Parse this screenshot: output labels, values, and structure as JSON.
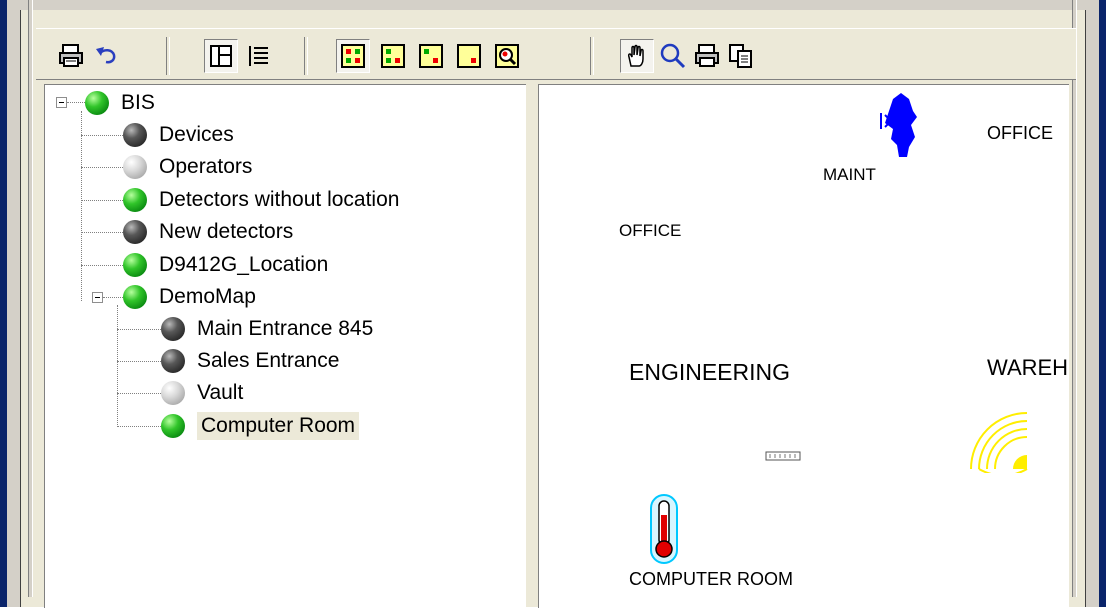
{
  "tree": {
    "root": {
      "label": "BIS",
      "status": "green"
    },
    "items": [
      {
        "label": "Devices",
        "status": "dark"
      },
      {
        "label": "Operators",
        "status": "light"
      },
      {
        "label": "Detectors without location",
        "status": "green"
      },
      {
        "label": "New detectors",
        "status": "dark"
      },
      {
        "label": "D9412G_Location",
        "status": "green"
      },
      {
        "label": "DemoMap",
        "status": "green"
      }
    ],
    "demomap_children": [
      {
        "label": "Main Entrance 845",
        "status": "dark"
      },
      {
        "label": "Sales Entrance",
        "status": "dark"
      },
      {
        "label": "Vault",
        "status": "light"
      },
      {
        "label": "Computer Room",
        "status": "green",
        "selected": true
      }
    ]
  },
  "map": {
    "labels": {
      "office_top_right": "OFFICE",
      "maint": "MAINT",
      "office_left": "OFFICE",
      "engineering": "ENGINEERING",
      "warehouse": "WAREH",
      "computer_room": "COMPUTER  ROOM"
    },
    "icons": [
      "door-detector-icon",
      "thermometer-icon",
      "wireless-signal-icon",
      "small-device-icon"
    ]
  },
  "toolbar": {
    "icons": [
      "print-icon",
      "undo-icon",
      "split-view-icon",
      "list-view-icon",
      "show-all-states-icon",
      "show-alarm-states-icon",
      "show-fault-states-icon",
      "show-trouble-states-icon",
      "zoom-detector-icon",
      "pan-hand-icon",
      "zoom-icon",
      "print-map-icon",
      "copy-icon"
    ]
  },
  "colors": {
    "accent": "#0a246a",
    "green": "#1fbf1f",
    "blue_icon": "#0000ff",
    "yellow": "#ffee00"
  }
}
